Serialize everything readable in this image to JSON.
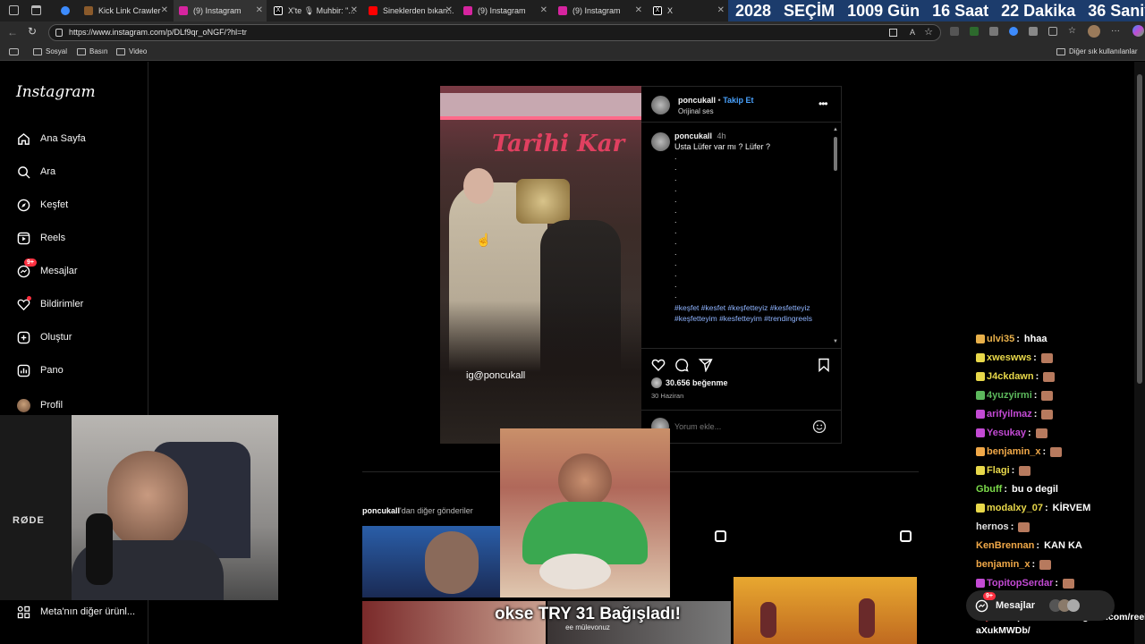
{
  "browser": {
    "tabs": [
      {
        "label": "",
        "fav_color": "#3d8bfd"
      },
      {
        "label": "Kick Link Crawler",
        "fav_color": "#8a5a2b"
      },
      {
        "label": "(9) Instagram",
        "fav_color": "#d6249f"
      },
      {
        "label": "X'te 🎙 Muhbir: \"...",
        "fav_color": "#ffffff"
      },
      {
        "label": "Sineklerden bıkan...",
        "fav_color": "#ff0000"
      },
      {
        "label": "(9) Instagram",
        "fav_color": "#d6249f"
      },
      {
        "label": "(9) Instagram",
        "fav_color": "#d6249f"
      },
      {
        "label": "X",
        "fav_color": "#ffffff"
      }
    ],
    "url": "https://www.instagram.com/p/DLf9qr_oNGF/?hl=tr",
    "bookmarks": [
      "Sosyal",
      "Basın",
      "Video"
    ],
    "other_bookmarks": "Diğer sık kullanılanlar"
  },
  "countdown": {
    "year_label": "2028",
    "word": "SEÇİM",
    "days": "1009 Gün",
    "hours": "16 Saat",
    "minutes": "22 Dakika",
    "seconds": "36 Saniye"
  },
  "instagram": {
    "logo": "Instagram",
    "nav": [
      {
        "label": "Ana Sayfa",
        "icon": "home-icon"
      },
      {
        "label": "Ara",
        "icon": "search-icon"
      },
      {
        "label": "Keşfet",
        "icon": "compass-icon"
      },
      {
        "label": "Reels",
        "icon": "reels-icon"
      },
      {
        "label": "Mesajlar",
        "icon": "messenger-icon",
        "badge": "9+"
      },
      {
        "label": "Bildirimler",
        "icon": "heart-icon"
      },
      {
        "label": "Oluştur",
        "icon": "plus-square-icon"
      },
      {
        "label": "Pano",
        "icon": "dashboard-icon"
      },
      {
        "label": "Profil",
        "icon": "avatar-icon"
      }
    ],
    "more_label": "Meta'nın diğer ürünl...",
    "post": {
      "username": "poncukall",
      "follow": "Takip Et",
      "audio": "Orijinal ses",
      "caption_time": "4h",
      "caption": "Usta Lüfer var mı ? Lüfer ?",
      "hashtags": "#keşfet #kesfet #keşfetteyiz #kesfetteyiz #keşfetteyim #kesfetteyim #trendingreels",
      "likes": "30.656 beğenme",
      "date": "30 Haziran",
      "comment_placeholder": "Yorum ekle...",
      "video_watermark": "ig@poncukall",
      "video_sign": "Tarihi Kar"
    },
    "more_posts_user": "poncukall",
    "more_posts_suffix": "'dan diğer gönderiler",
    "messages_label": "Mesajlar",
    "messages_badge": "9+"
  },
  "stream": {
    "webcam_label": "RØDE",
    "donation": "okse TRY 31 Bağışladı!",
    "donation_sub": "ee mülevonuz",
    "chat": [
      {
        "user": "ulvi35",
        "msg": "hhaa",
        "color": "#e8b04a"
      },
      {
        "user": "xweswws",
        "msg": "",
        "color": "#e8d84a"
      },
      {
        "user": "J4ckdawn",
        "msg": "",
        "color": "#e8d84a"
      },
      {
        "user": "4yuzyirmi",
        "msg": "",
        "color": "#5cb85c"
      },
      {
        "user": "arifyilmaz",
        "msg": "",
        "color": "#c34ad4"
      },
      {
        "user": "Yesukay",
        "msg": "",
        "color": "#c34ad4"
      },
      {
        "user": "benjamin_x",
        "msg": "",
        "color": "#f0a848"
      },
      {
        "user": "Flagi",
        "msg": "",
        "color": "#e8d84a"
      },
      {
        "user": "Gbuff",
        "msg": "bu o degil",
        "color": "#7cdc4a"
      },
      {
        "user": "modalxy_07",
        "msg": "KİRVEM",
        "color": "#e8d84a"
      },
      {
        "user": "hernos",
        "msg": "",
        "color": "#e0e0e0"
      },
      {
        "user": "KenBrennan",
        "msg": "KAN KA",
        "color": "#f0a848"
      },
      {
        "user": "benjamin_x",
        "msg": "",
        "color": "#f0a848"
      },
      {
        "user": "TopitopSerdar",
        "msg": "",
        "color": "#c34ad4"
      },
      {
        "user": "Diyar",
        "msg": "https://www.instagram.com/reel/DF-aXukMWDb/",
        "color": "#b03a3a"
      }
    ]
  }
}
